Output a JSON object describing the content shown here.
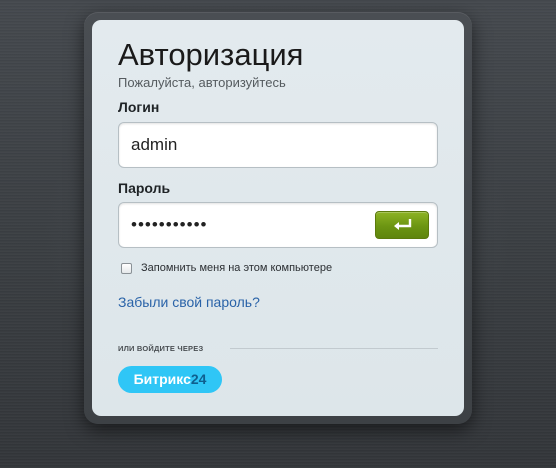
{
  "auth": {
    "title": "Авторизация",
    "subtitle": "Пожалуйста, авторизуйтесь",
    "login_label": "Логин",
    "login_value": "admin",
    "password_label": "Пароль",
    "password_value": "•••••••••••",
    "submit_icon": "enter-arrow-icon",
    "remember_label": "Запомнить меня на этом компьютере",
    "remember_checked": false,
    "forgot_link": "Забыли свой пароль?",
    "or_login_via": "ИЛИ ВОЙДИТЕ ЧЕРЕЗ",
    "provider": {
      "name": "Битрикс",
      "number": "24"
    }
  },
  "colors": {
    "submit_button": "#6c9512",
    "link": "#2a63a8",
    "provider_button": "#2fc6f6",
    "card_background": "#dde6ea"
  }
}
